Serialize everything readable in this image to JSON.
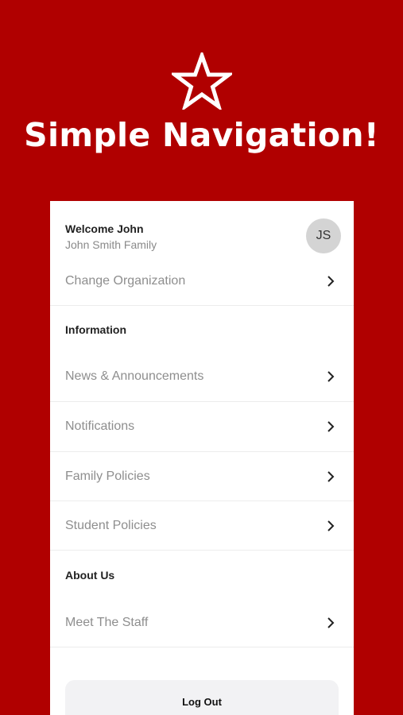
{
  "hero": {
    "title": "Simple Navigation!",
    "icon": "star-outline-icon"
  },
  "profile": {
    "welcome": "Welcome John",
    "family": "John Smith Family",
    "initials": "JS"
  },
  "change_org": {
    "label": "Change Organization"
  },
  "sections": [
    {
      "title": "Information",
      "items": [
        {
          "label": "News & Announcements"
        },
        {
          "label": "Notifications"
        },
        {
          "label": "Family Policies"
        },
        {
          "label": "Student Policies"
        }
      ]
    },
    {
      "title": "About Us",
      "items": [
        {
          "label": "Meet The Staff"
        }
      ]
    }
  ],
  "logout": {
    "label": "Log Out"
  },
  "colors": {
    "background": "#b00000",
    "panel": "#ffffff",
    "button": "#f2f2f4"
  }
}
